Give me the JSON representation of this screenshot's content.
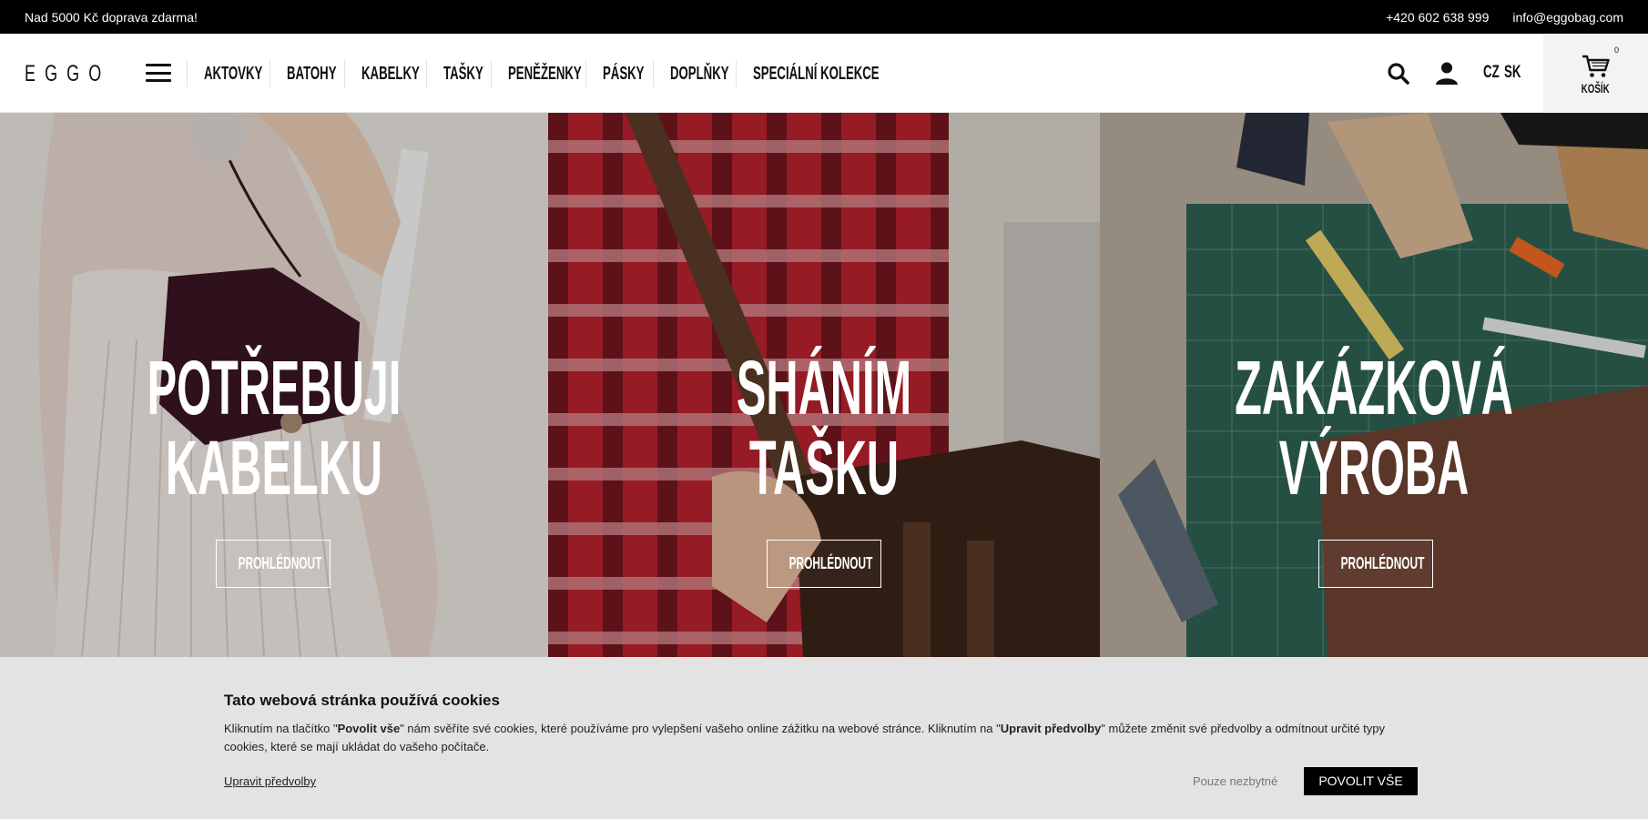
{
  "topbar": {
    "promo": "Nad 5000 Kč doprava zdarma!",
    "phone": "+420 602 638 999",
    "email": "info@eggobag.com"
  },
  "header": {
    "logo": "EGGO",
    "nav": [
      "AKTOVKY",
      "BATOHY",
      "KABELKY",
      "TAŠKY",
      "PENĚŽENKY",
      "PÁSKY",
      "DOPLŇKY",
      "SPECIÁLNÍ KOLEKCE"
    ],
    "languages": [
      "CZ",
      "SK"
    ],
    "active_language": "CZ",
    "cart_label": "KOŠÍK",
    "cart_count": "0",
    "icons": [
      "menu-icon",
      "search-icon",
      "user-icon",
      "cart-icon"
    ]
  },
  "hero": {
    "panels": [
      {
        "title_line1": "POTŘEBUJI",
        "title_line2": "KABELKU",
        "button": "PROHLÉDNOUT"
      },
      {
        "title_line1": "SHÁNÍM",
        "title_line2": "TAŠKU",
        "button": "PROHLÉDNOUT"
      },
      {
        "title_line1": "ZAKÁZKOVÁ",
        "title_line2": "VÝROBA",
        "button": "PROHLÉDNOUT"
      }
    ]
  },
  "cookie": {
    "title": "Tato webová stránka používá cookies",
    "text_1": "Kliknutím na tlačítko \"",
    "bold_1": "Povolit vše",
    "text_2": "\" nám svěříte své cookies, které používáme pro vylepšení vašeho online zážitku na webové stránce. Kliknutím na \"",
    "bold_2": "Upravit předvolby",
    "text_3": "\" můžete změnit své předvolby a odmítnout určité typy cookies, které se mají ukládat do vašeho počítače.",
    "prefs_link": "Upravit předvolby",
    "necessary_button": "Pouze nezbytné",
    "allow_button": "POVOLIT VŠE"
  },
  "colors": {
    "topbar_bg": "#000000",
    "cookie_bg": "#e3e3e3",
    "accent": "#000000"
  }
}
